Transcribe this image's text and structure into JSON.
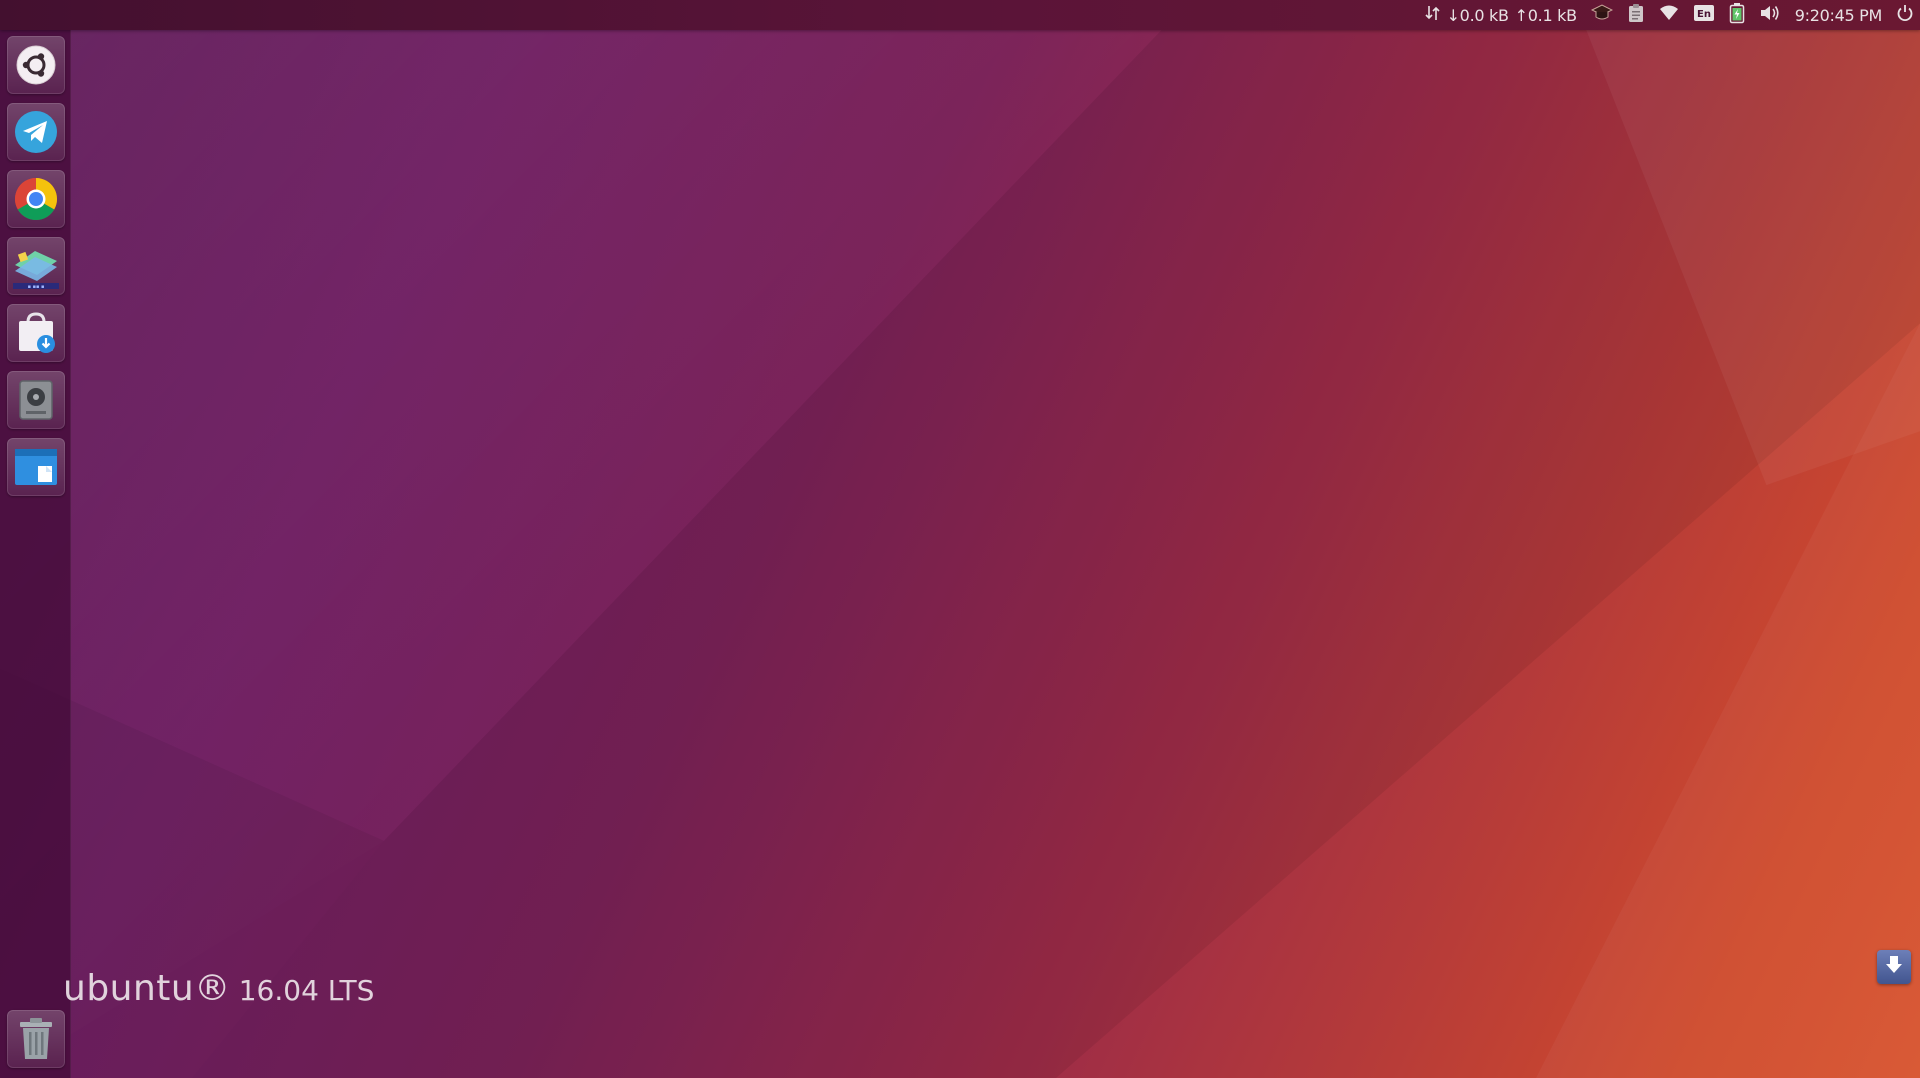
{
  "top_panel": {
    "network_speed": {
      "icon": "network-transfer-icon",
      "download": "↓0.0 kB",
      "upload": "↑0.1 kB"
    },
    "indicators": [
      {
        "name": "graduation-cap-icon"
      },
      {
        "name": "clipboard-icon"
      },
      {
        "name": "wifi-icon"
      },
      {
        "name": "keyboard-layout-icon"
      },
      {
        "name": "battery-icon"
      },
      {
        "name": "volume-icon"
      }
    ],
    "clock": "9:20:45 PM",
    "power_icon": "power-icon"
  },
  "launcher": {
    "items": [
      {
        "name": "dash-home",
        "icon": "ubuntu-logo-icon"
      },
      {
        "name": "telegram",
        "icon": "telegram-icon"
      },
      {
        "name": "chrome",
        "icon": "chrome-icon"
      },
      {
        "name": "app-launcher-item",
        "icon": "stack-app-icon"
      },
      {
        "name": "software-center",
        "icon": "shopping-bag-icon"
      },
      {
        "name": "disk-utility",
        "icon": "disk-icon"
      },
      {
        "name": "file-manager",
        "icon": "window-icon"
      },
      {
        "name": "trash",
        "icon": "trash-icon"
      }
    ]
  },
  "branding": {
    "name": "ubuntu®",
    "version": "16.04 LTS"
  },
  "download_widget": {
    "icon": "download-arrow-icon"
  },
  "colors": {
    "top_panel": "#4a1234",
    "launcher": "#460c3a",
    "wallpaper_start": "#5e1a58",
    "wallpaper_end": "#d8542e"
  }
}
